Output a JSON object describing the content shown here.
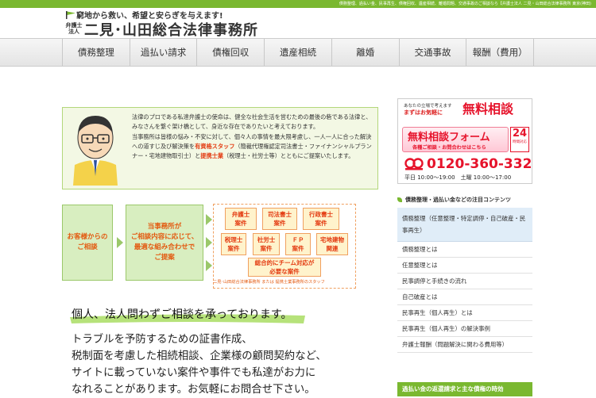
{
  "topbar": {
    "text": "債務整理、過払い金、民事再生、債権回収、遺産相続、離婚問題、交通事故のご相談なら【弁護士法人 二見・山田総合法律事務所 東京(神田)"
  },
  "header": {
    "tagline": "窮地から救い、希望と安らぎを与えます!",
    "firm_type_line1": "弁護士",
    "firm_type_line2": "法人",
    "firm_name": "二見･山田総合法律事務所"
  },
  "nav": {
    "items": [
      "債務整理",
      "過払い請求",
      "債権回収",
      "遺産相続",
      "離婚",
      "交通事故",
      "報酬（費用）"
    ]
  },
  "intro": {
    "p1": "法律のプロである私達弁護士の使命は、健全な社会生活を営むための最後の砦である法律と、みなさんを繋ぐ架け橋として、身近な存在でありたいと考えております。",
    "p2a": "当事務所は皆様の悩み・不安に対して、個々人の事情を最大限考慮し、一人一人に合った解決への道すじ及び解決策を",
    "p2_hl1": "有資格スタッフ",
    "p2b": "（簡裁代理権認定司法書士・ファイナンシャルプランナー・宅地建物取引士）と",
    "p2_hl2": "提携士業",
    "p2c": "（税理士・社労士等）とともにご提案いたします。"
  },
  "flow": {
    "customer_l1": "お客様からの",
    "customer_l2": "ご相談",
    "firm_l1": "当事務所が",
    "firm_l2": "ご相談内容に応じて、",
    "firm_l3": "最適な組み合わせで",
    "firm_l4": "ご提案",
    "team": [
      {
        "l1": "弁護士",
        "l2": "案件"
      },
      {
        "l1": "司法書士",
        "l2": "案件"
      },
      {
        "l1": "行政書士",
        "l2": "案件"
      },
      {
        "l1": "税理士",
        "l2": "案件"
      },
      {
        "l1": "社労士",
        "l2": "案件"
      },
      {
        "l1": "ＦＰ",
        "l2": "案件"
      },
      {
        "l1": "宅地建物",
        "l2": "関連"
      }
    ],
    "team_l1": "総合的にチーム対応が",
    "team_l2": "必要な案件",
    "caption": "二見･山田総合法律事務所 または 提携士業事務所のスタッフ"
  },
  "main": {
    "greeting": "個人、法人問わずご相談を承っております。",
    "body_l1": "トラブルを予防するための証書作成、",
    "body_l2": "税制面を考慮した相続相談、企業様の顧問契約など、",
    "body_l3": "サイトに載っていない案件や事件でも私達がお力に",
    "body_l4": "なれることがあります。お気軽にお問合せ下さい。"
  },
  "cta": {
    "line1": "あなたの立場で考えます",
    "line2": "まずはお気軽に",
    "big": "無料相談",
    "form_title": "無料相談フォーム",
    "form_sub": "各種ご相談・お問合わせはこちら",
    "badge_num": "24",
    "badge_label": "時間対応",
    "phone": "0120-360-332",
    "hours": "平日 10:00～19:00　土曜 10:00～17:00"
  },
  "sidebar": {
    "heading": "債務整理・過払い金などの注目コンテンツ",
    "items": [
      "債務整理（任意整理・特定調停・自己破産・民事再生）",
      "債務整理とは",
      "任意整理とは",
      "民事調停と手続きの流れ",
      "自己破産とは",
      "民事再生（個人再生）とは",
      "民事再生（個人再生）の解決事例",
      "弁護士報酬（問題解決に関わる費用等）"
    ],
    "bottom": "過払い金の返還請求と主な債権の時効"
  },
  "colors": {
    "brand_green": "#7ab830",
    "accent_red": "#e6132b",
    "accent_orange": "#e35a10"
  }
}
